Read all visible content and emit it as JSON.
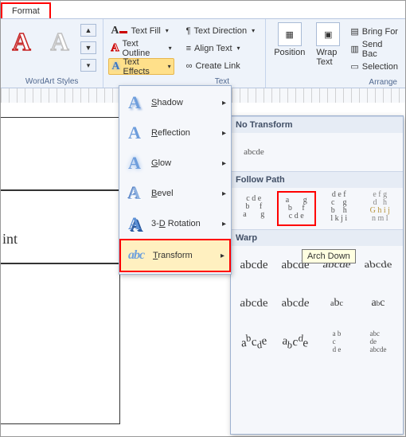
{
  "tab": {
    "label": "Format"
  },
  "ribbon": {
    "wordart": {
      "group_label": "WordArt Styles",
      "sample": "A"
    },
    "text_fill": {
      "label": "Text Fill"
    },
    "text_outline": {
      "label": "Text Outline"
    },
    "text_effects": {
      "label": "Text Effects"
    },
    "text_group": {
      "direction": {
        "label": "Text Direction"
      },
      "align": {
        "label": "Align Text"
      },
      "create_link": {
        "label": "Create Link"
      },
      "group_label": "Text"
    },
    "arrange": {
      "position": {
        "label": "Position"
      },
      "wrap": {
        "label": "Wrap Text"
      },
      "bring": {
        "label": "Bring For"
      },
      "send": {
        "label": "Send Bac"
      },
      "selection": {
        "label": "Selection"
      },
      "group_label": "Arrange"
    }
  },
  "effects_menu": {
    "shadow": {
      "label": "Shadow",
      "accel": "S"
    },
    "reflection": {
      "label": "Reflection",
      "accel": "R"
    },
    "glow": {
      "label": "Glow",
      "accel": "G"
    },
    "bevel": {
      "label": "Bevel",
      "accel": "B"
    },
    "rotation": {
      "label": "3-D Rotation",
      "accel": "D"
    },
    "transform": {
      "label": "Transform",
      "accel": "T"
    }
  },
  "gallery": {
    "no_transform": {
      "header": "No Transform",
      "sample": "abcde"
    },
    "follow_path": {
      "header": "Follow Path",
      "items": [
        {
          "name": "arch-up",
          "highlight": false
        },
        {
          "name": "arch-down",
          "highlight": true,
          "tooltip": "Arch Down"
        },
        {
          "name": "circle",
          "highlight": false
        },
        {
          "name": "button",
          "highlight": false
        }
      ]
    },
    "warp": {
      "header": "Warp",
      "sample": "abcde",
      "rows": 3,
      "cols": 4
    }
  },
  "document": {
    "text": "int"
  },
  "tooltip": "Arch Down"
}
